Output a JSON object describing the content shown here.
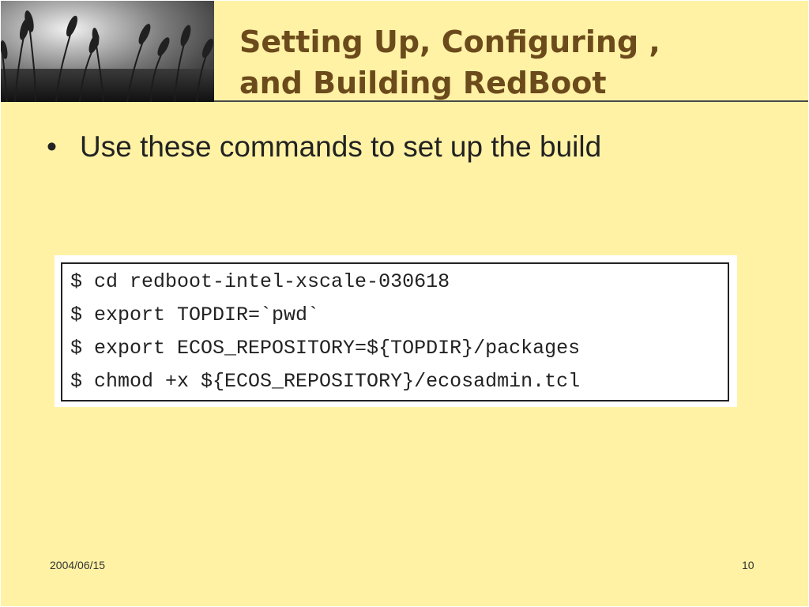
{
  "slide": {
    "title": "Setting Up, Configuring ,\nand Building RedBoot",
    "bullets": [
      {
        "marker": "•",
        "text": "Use these commands to set up the build"
      }
    ],
    "code_lines": [
      "$ cd redboot-intel-xscale-030618",
      "$ export TOPDIR=`pwd`",
      "$ export ECOS_REPOSITORY=${TOPDIR}/packages",
      "$ chmod +x ${ECOS_REPOSITORY}/ecosadmin.tcl"
    ],
    "footer": {
      "date": "2004/06/15",
      "page_number": "10"
    }
  },
  "colors": {
    "background": "#fff2a5",
    "title": "#6b4a1b",
    "body_text": "#222222"
  }
}
